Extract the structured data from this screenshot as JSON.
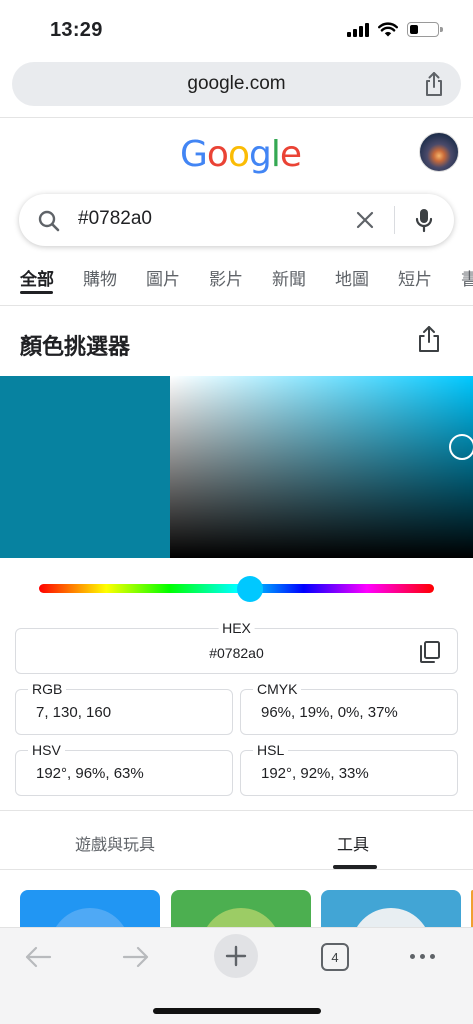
{
  "status_bar": {
    "time": "13:29"
  },
  "browser": {
    "url": "google.com",
    "open_tabs": "4"
  },
  "search": {
    "query": "#0782a0"
  },
  "tabs": [
    {
      "label": "全部",
      "active": true
    },
    {
      "label": "購物"
    },
    {
      "label": "圖片"
    },
    {
      "label": "影片"
    },
    {
      "label": "新聞"
    },
    {
      "label": "地圖"
    },
    {
      "label": "短片"
    },
    {
      "label": "書"
    }
  ],
  "color_picker": {
    "title": "顏色挑選器",
    "color": "#0782a0",
    "hue_color": "#00c8ff",
    "hue_position": 0.535,
    "hex_label": "HEX",
    "hex_value": "#0782a0",
    "rgb_label": "RGB",
    "rgb_value": "7, 130, 160",
    "cmyk_label": "CMYK",
    "cmyk_value": "96%, 19%, 0%, 37%",
    "hsv_label": "HSV",
    "hsv_value": "192°, 96%, 63%",
    "hsl_label": "HSL",
    "hsl_value": "192°, 92%, 33%"
  },
  "bottom_tabs": [
    {
      "label": "遊戲與玩具"
    },
    {
      "label": "工具",
      "active": true
    }
  ],
  "colors": {
    "google_blue": "#4285F4",
    "google_red": "#EA4335",
    "google_yellow": "#FBBC05",
    "google_green": "#34A853"
  }
}
